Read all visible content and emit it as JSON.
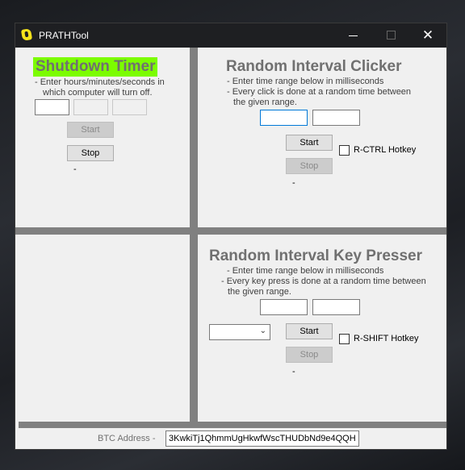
{
  "window": {
    "title": "PRATHTool"
  },
  "titlebar": {
    "minimize_icon": "minimize-icon",
    "maximize_icon": "maximize-icon",
    "close_icon": "close-icon",
    "close_glyph": "✕"
  },
  "shutdown": {
    "title": "Shutdown Timer",
    "desc_line1": "- Enter hours/minutes/seconds in",
    "desc_line2": "which computer will turn off.",
    "hours_value": "",
    "minutes_value": "",
    "seconds_value": "",
    "start_label": "Start",
    "stop_label": "Stop",
    "status": "-",
    "accent_color": "#7cfc00"
  },
  "clicker": {
    "title": "Random Interval Clicker",
    "desc_line1": "- Enter time range below in milliseconds",
    "desc_line2": "- Every click is done at a random time between",
    "desc_line3": "the given range.",
    "min_value": "",
    "max_value": "",
    "start_label": "Start",
    "stop_label": "Stop",
    "hotkey_label": "R-CTRL Hotkey",
    "hotkey_checked": false,
    "status": "-"
  },
  "presser": {
    "title": "Random Interval Key Presser",
    "desc_line1": "- Enter time range below in milliseconds",
    "desc_line2": "- Every key press is done at a random time between",
    "desc_line3": "the given range.",
    "min_value": "",
    "max_value": "",
    "key_select_value": "",
    "start_label": "Start",
    "stop_label": "Stop",
    "hotkey_label": "R-SHIFT Hotkey",
    "hotkey_checked": false,
    "status": "-"
  },
  "footer": {
    "btc_label": "BTC Address -",
    "btc_address": "3KwkiTj1QhmmUgHkwfWscTHUDbNd9e4QQH"
  }
}
